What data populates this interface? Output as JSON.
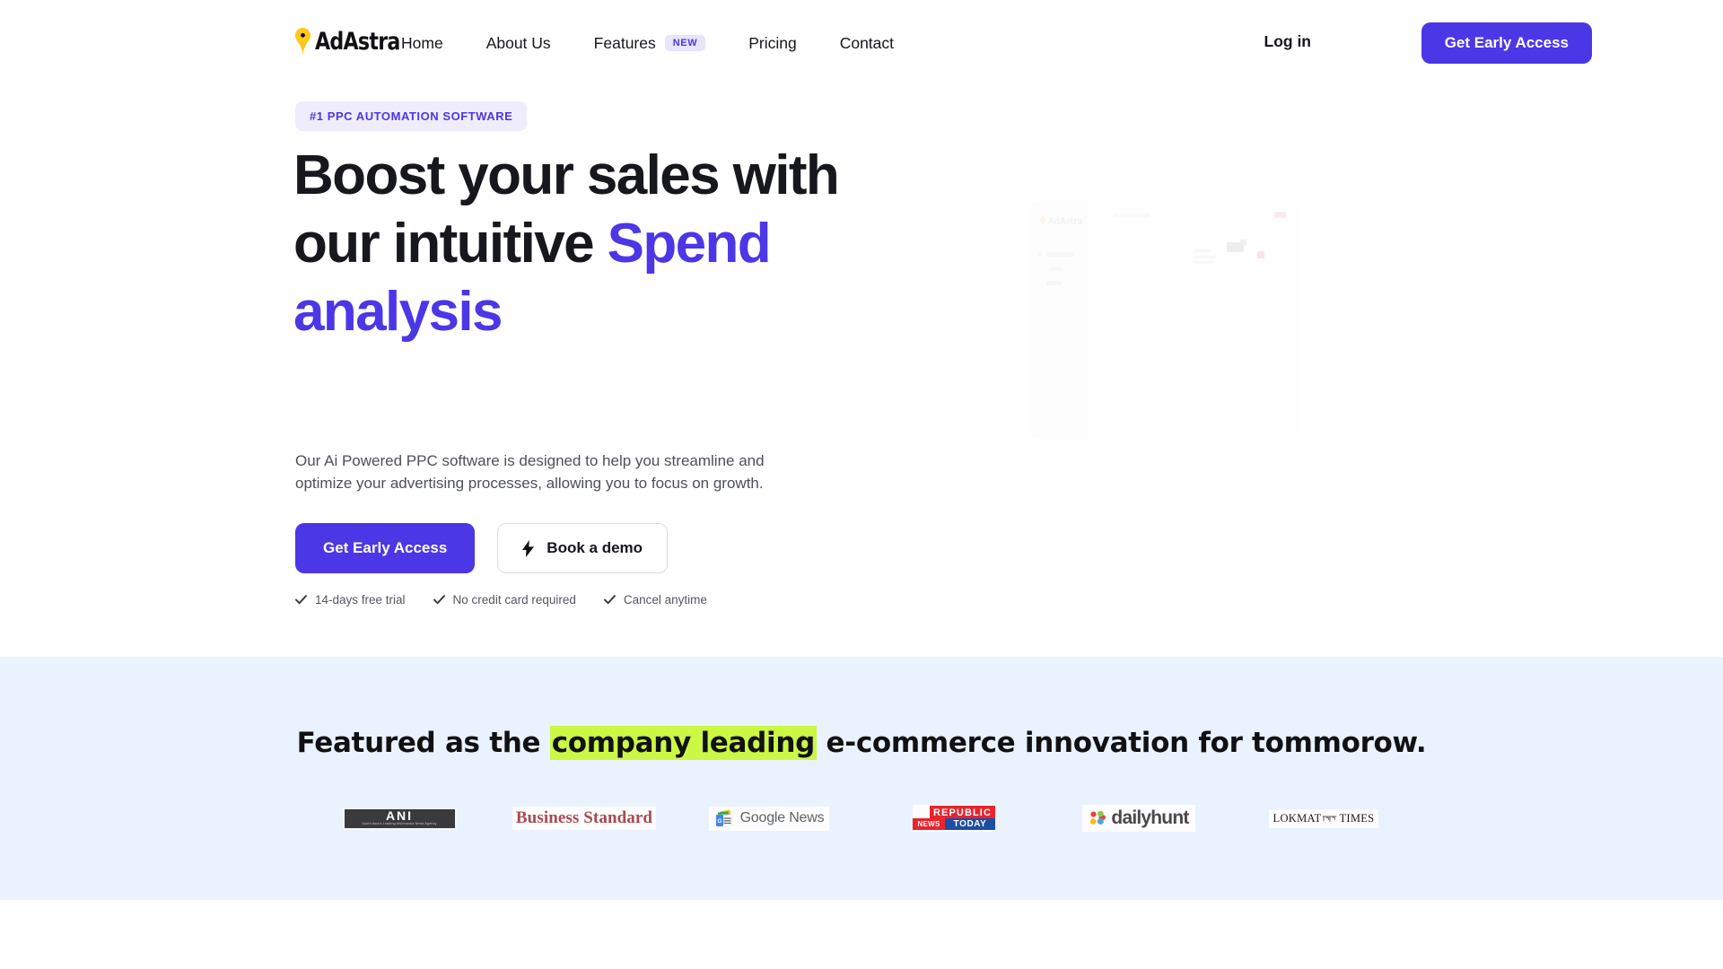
{
  "brand": {
    "name": "AdAstra",
    "logo_icon": "location-pin-icon",
    "accent_purple": "#4B37E6",
    "accent_yellow": "#FFC91C",
    "highlight_lime": "#CBF745",
    "featured_bg": "#E9F2FD"
  },
  "nav": {
    "links": [
      {
        "label": "Home"
      },
      {
        "label": "About Us"
      },
      {
        "label": "Features",
        "badge": "NEW"
      },
      {
        "label": "Pricing"
      },
      {
        "label": "Contact"
      }
    ],
    "login_label": "Log in",
    "cta_label": "Get Early Access"
  },
  "hero": {
    "badge": "#1 PPC AUTOMATION SOFTWARE",
    "headline_line1": "Boost your sales with",
    "headline_line2_plain": "our intuitive ",
    "headline_line2_accent": "Spend",
    "headline_line3_accent": "analysis",
    "subcopy": "Our Ai Powered PPC software is designed to help you streamline and optimize your advertising processes, allowing you to focus on growth.",
    "primary_cta": "Get Early Access",
    "secondary_cta": "Book a demo",
    "secondary_cta_icon": "lightning-bolt-icon",
    "trust_items": [
      {
        "icon": "check-icon",
        "label": "14-days free trial"
      },
      {
        "icon": "check-icon",
        "label": "No credit card required"
      },
      {
        "icon": "check-icon",
        "label": "Cancel anytime"
      }
    ],
    "mockup": {
      "label": "product-dashboard-preview",
      "logo_word": "AdAstra"
    }
  },
  "featured": {
    "title_before": "Featured as the ",
    "title_highlight": "company leading",
    "title_after": " e-commerce innovation for tommorow.",
    "logos": [
      {
        "name": "ani",
        "main": "ANI",
        "sub": "South Asia's Leading Multimedia News Agency"
      },
      {
        "name": "business-standard",
        "text": "Business Standard"
      },
      {
        "name": "google-news",
        "text": "Google News"
      },
      {
        "name": "republic-news-today",
        "top": "REPUBLIC",
        "left": "NEWS",
        "right": "TODAY"
      },
      {
        "name": "dailyhunt",
        "text": "dailyhunt"
      },
      {
        "name": "lokmat-times",
        "left": "LOKMAT",
        "right": "TIMES"
      }
    ]
  }
}
